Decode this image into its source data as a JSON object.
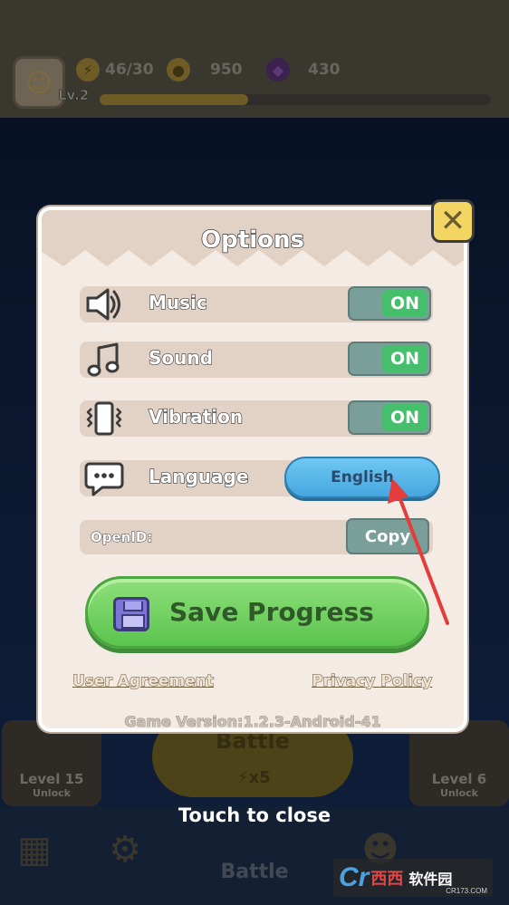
{
  "hud": {
    "level": "Lv.2",
    "xp_fraction": 0.38,
    "energy": "46/30",
    "coins": "950",
    "gems": "430"
  },
  "options": {
    "title": "Options",
    "rows": [
      {
        "label": "Music",
        "state": "ON",
        "icon": "speaker-icon"
      },
      {
        "label": "Sound",
        "state": "ON",
        "icon": "music-note-icon"
      },
      {
        "label": "Vibration",
        "state": "ON",
        "icon": "vibration-icon"
      }
    ],
    "language": {
      "label": "Language",
      "value": "English",
      "icon": "chat-bubble-icon"
    },
    "openid": {
      "label": "OpenID:",
      "button": "Copy"
    },
    "save_label": "Save Progress",
    "user_agreement": "User Agreement",
    "privacy_policy": "Privacy Policy",
    "version": "Game Version:1.2.3-Android-41",
    "close_icon": "close-x-icon"
  },
  "background": {
    "battle_label": "Battle",
    "battle_cost": "x5",
    "battle_tab": "Battle",
    "level_left": "Level 15",
    "level_left_sub": "Unlock",
    "level_right": "Level 6",
    "level_right_sub": "Unlock"
  },
  "touch_to_close": "Touch to close",
  "watermark": {
    "logo": "Cr",
    "brand": "西西",
    "cn": "软件园",
    "url": "CR173.COM"
  },
  "colors": {
    "dialog_bg": "#f3ebe4",
    "row_bg": "#e2d2c6",
    "toggle_on": "#45bf6c",
    "language_button": "#58b6e8",
    "save_button": "#5bc44e",
    "close_button": "#f3d563",
    "annotation_arrow": "#e63b3b"
  }
}
